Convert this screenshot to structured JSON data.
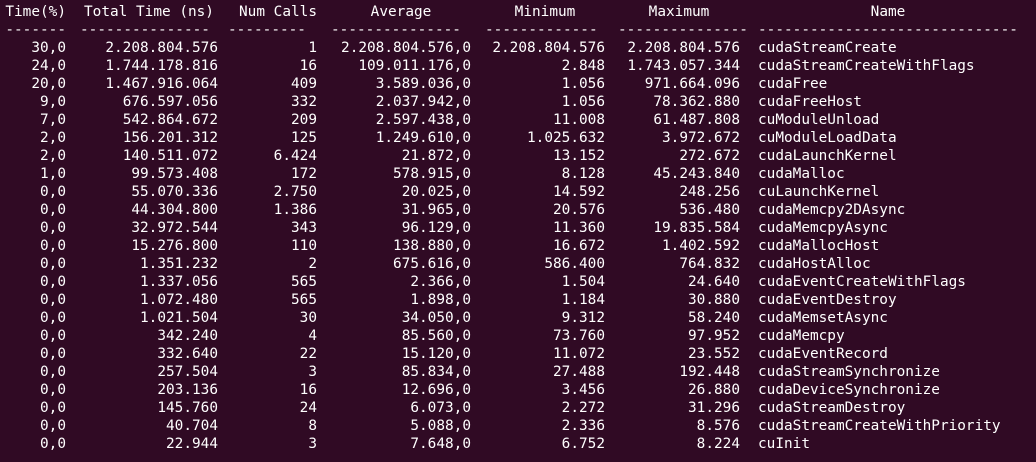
{
  "colors": {
    "background": "#300a24",
    "text": "#ffffff"
  },
  "table": {
    "headers": [
      "Time(%)",
      "Total Time (ns)",
      "Num Calls",
      "Average",
      "Minimum",
      "Maximum",
      "Name"
    ],
    "separators": [
      "-------",
      "---------------",
      "---------",
      "---------------",
      "-------------",
      "---------------",
      "------------------------------"
    ],
    "rows": [
      [
        "30,0",
        "2.208.804.576",
        "1",
        "2.208.804.576,0",
        "2.208.804.576",
        "2.208.804.576",
        "cudaStreamCreate"
      ],
      [
        "24,0",
        "1.744.178.816",
        "16",
        "109.011.176,0",
        "2.848",
        "1.743.057.344",
        "cudaStreamCreateWithFlags"
      ],
      [
        "20,0",
        "1.467.916.064",
        "409",
        "3.589.036,0",
        "1.056",
        "971.664.096",
        "cudaFree"
      ],
      [
        "9,0",
        "676.597.056",
        "332",
        "2.037.942,0",
        "1.056",
        "78.362.880",
        "cudaFreeHost"
      ],
      [
        "7,0",
        "542.864.672",
        "209",
        "2.597.438,0",
        "11.008",
        "61.487.808",
        "cuModuleUnload"
      ],
      [
        "2,0",
        "156.201.312",
        "125",
        "1.249.610,0",
        "1.025.632",
        "3.972.672",
        "cuModuleLoadData"
      ],
      [
        "2,0",
        "140.511.072",
        "6.424",
        "21.872,0",
        "13.152",
        "272.672",
        "cudaLaunchKernel"
      ],
      [
        "1,0",
        "99.573.408",
        "172",
        "578.915,0",
        "8.128",
        "45.243.840",
        "cudaMalloc"
      ],
      [
        "0,0",
        "55.070.336",
        "2.750",
        "20.025,0",
        "14.592",
        "248.256",
        "cuLaunchKernel"
      ],
      [
        "0,0",
        "44.304.800",
        "1.386",
        "31.965,0",
        "20.576",
        "536.480",
        "cudaMemcpy2DAsync"
      ],
      [
        "0,0",
        "32.972.544",
        "343",
        "96.129,0",
        "11.360",
        "19.835.584",
        "cudaMemcpyAsync"
      ],
      [
        "0,0",
        "15.276.800",
        "110",
        "138.880,0",
        "16.672",
        "1.402.592",
        "cudaMallocHost"
      ],
      [
        "0,0",
        "1.351.232",
        "2",
        "675.616,0",
        "586.400",
        "764.832",
        "cudaHostAlloc"
      ],
      [
        "0,0",
        "1.337.056",
        "565",
        "2.366,0",
        "1.504",
        "24.640",
        "cudaEventCreateWithFlags"
      ],
      [
        "0,0",
        "1.072.480",
        "565",
        "1.898,0",
        "1.184",
        "30.880",
        "cudaEventDestroy"
      ],
      [
        "0,0",
        "1.021.504",
        "30",
        "34.050,0",
        "9.312",
        "58.240",
        "cudaMemsetAsync"
      ],
      [
        "0,0",
        "342.240",
        "4",
        "85.560,0",
        "73.760",
        "97.952",
        "cudaMemcpy"
      ],
      [
        "0,0",
        "332.640",
        "22",
        "15.120,0",
        "11.072",
        "23.552",
        "cudaEventRecord"
      ],
      [
        "0,0",
        "257.504",
        "3",
        "85.834,0",
        "27.488",
        "192.448",
        "cudaStreamSynchronize"
      ],
      [
        "0,0",
        "203.136",
        "16",
        "12.696,0",
        "3.456",
        "26.880",
        "cudaDeviceSynchronize"
      ],
      [
        "0,0",
        "145.760",
        "24",
        "6.073,0",
        "2.272",
        "31.296",
        "cudaStreamDestroy"
      ],
      [
        "0,0",
        "40.704",
        "8",
        "5.088,0",
        "2.336",
        "8.576",
        "cudaStreamCreateWithPriority"
      ],
      [
        "0,0",
        "22.944",
        "3",
        "7.648,0",
        "6.752",
        "8.224",
        "cuInit"
      ]
    ]
  }
}
